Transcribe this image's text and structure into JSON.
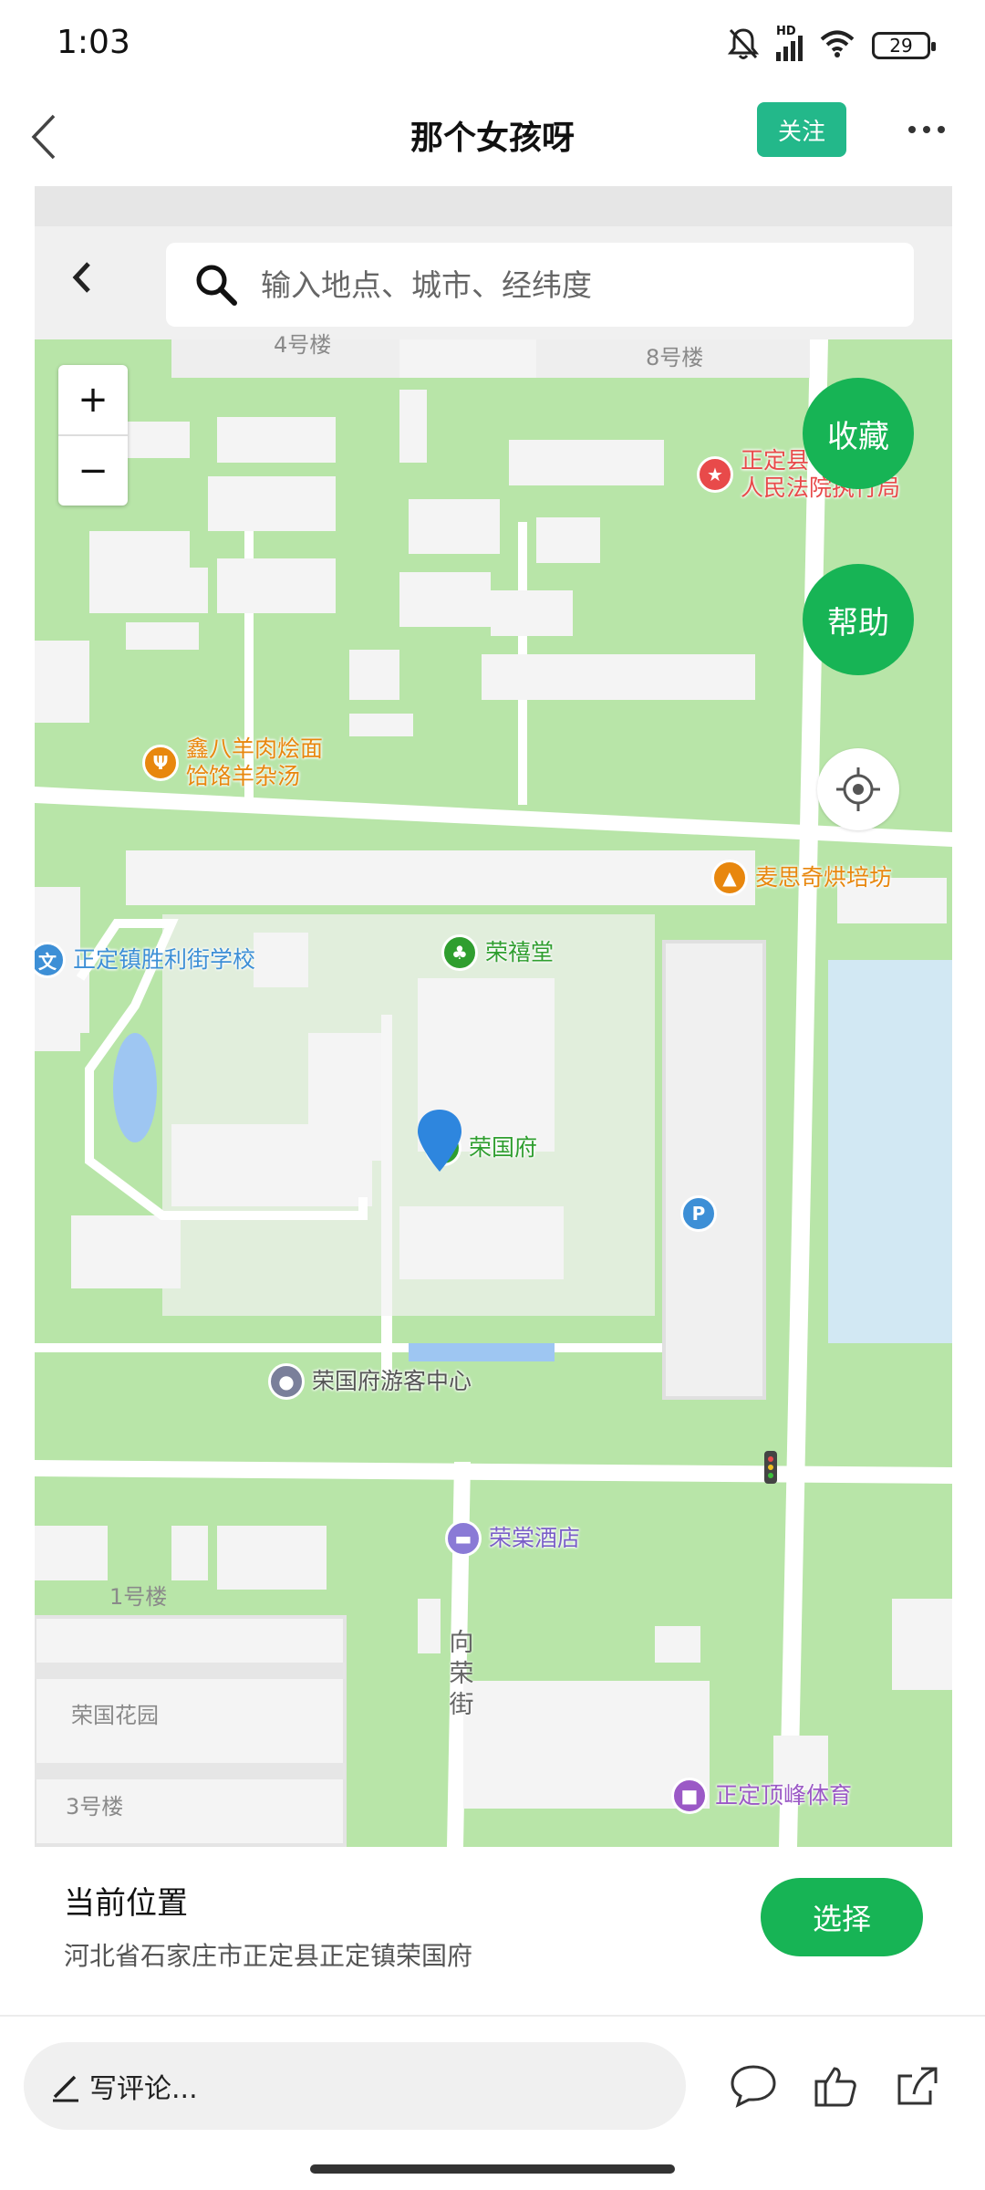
{
  "status_bar": {
    "time": "1:03",
    "network": "HD",
    "battery": "29"
  },
  "navbar": {
    "title": "那个女孩呀",
    "follow_label": "关注"
  },
  "map": {
    "search_placeholder": "输入地点、城市、经纬度",
    "zoom_in": "+",
    "zoom_out": "−",
    "favorite_label": "收藏",
    "help_label": "帮助",
    "building_labels": {
      "building_4": "4号楼",
      "building_8": "8号楼",
      "building_1": "1号楼",
      "garden": "荣国花园",
      "building_3": "3号楼"
    },
    "street_label": "向荣街",
    "pois": {
      "court": "正定县人民法院执行局",
      "court_line1": "正定县",
      "court_line2": "人民法院执行局",
      "restaurant_line1": "鑫八羊肉烩面",
      "restaurant_line2": "饸饹羊杂汤",
      "bakery": "麦思奇烘培坊",
      "school": "正定镇胜利街学校",
      "school_icon": "文",
      "rongxi_hall": "荣禧堂",
      "rongguo_mansion": "荣国府",
      "parking_icon": "P",
      "visitor_center": "荣国府游客中心",
      "hotel": "荣棠酒店",
      "sports": "正定顶峰体育"
    },
    "colors": {
      "park_green": "#b8e5a8",
      "building": "#f4f4f4",
      "water": "#d2e8f3",
      "accent_green": "#17b455",
      "poi_green": "#2f9e2f",
      "poi_orange": "#e8870e",
      "poi_blue": "#3d8fd6",
      "poi_purple": "#9b59c6",
      "poi_red": "#e84a4a",
      "pin_blue": "#2e86de"
    }
  },
  "location": {
    "title": "当前位置",
    "address": "河北省石家庄市正定县正定镇荣国府",
    "select_label": "选择"
  },
  "comment_bar": {
    "placeholder": "写评论..."
  },
  "icons": {
    "back": "back-icon",
    "more": "more-icon",
    "search": "search-icon",
    "locate": "locate-icon",
    "comment": "comment-icon",
    "like": "thumbs-up-icon",
    "share": "share-icon",
    "pencil": "pencil-icon"
  }
}
